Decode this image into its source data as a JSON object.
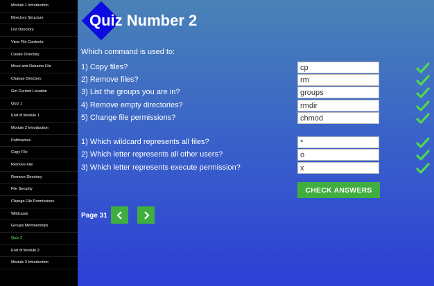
{
  "sidebar": {
    "items": [
      {
        "label": "Module 1 Introduction",
        "active": false
      },
      {
        "label": "Directory Structure",
        "active": false
      },
      {
        "label": "List Directory",
        "active": false
      },
      {
        "label": "View File Contents",
        "active": false
      },
      {
        "label": "Create Directory",
        "active": false
      },
      {
        "label": "Move and Rename File",
        "active": false
      },
      {
        "label": "Change Directory",
        "active": false
      },
      {
        "label": "Get Current Location",
        "active": false
      },
      {
        "label": "Quiz 1",
        "active": false
      },
      {
        "label": "End of Module 1",
        "active": false
      },
      {
        "label": "Module 2 Introduction",
        "active": false
      },
      {
        "label": "Pathnames",
        "active": false
      },
      {
        "label": "Copy File",
        "active": false
      },
      {
        "label": "Remove File",
        "active": false
      },
      {
        "label": "Remove Directory",
        "active": false
      },
      {
        "label": "File Security",
        "active": false
      },
      {
        "label": "Change File Permissions",
        "active": false
      },
      {
        "label": "Wildcards",
        "active": false
      },
      {
        "label": "Groups Memberships",
        "active": false
      },
      {
        "label": "Quiz 2",
        "active": true
      },
      {
        "label": "End of Module 2",
        "active": false
      },
      {
        "label": "Module 3 Introduction",
        "active": false
      }
    ]
  },
  "quiz": {
    "title": "Quiz Number 2",
    "intro": "Which command is used to:",
    "questions": [
      {
        "label": "1) Copy files?",
        "answer": "cp",
        "correct": true
      },
      {
        "label": "2) Remove files?",
        "answer": "rm",
        "correct": true
      },
      {
        "label": "3) List the groups you are in?",
        "answer": "groups",
        "correct": true
      },
      {
        "label": "4) Remove empty directories?",
        "answer": "rmdir",
        "correct": true
      },
      {
        "label": "5) Change file permissions?",
        "answer": "chmod",
        "correct": true
      },
      {
        "label": "1) Which wildcard represents all files?",
        "answer": "*",
        "correct": true
      },
      {
        "label": "2) Which letter represents all other users?",
        "answer": "o",
        "correct": true
      },
      {
        "label": "3) Which letter represents execute permission?",
        "answer": "x",
        "correct": true
      }
    ],
    "check_button_label": "CHECK ANSWERS",
    "page_label": "Page 31",
    "prev_icon": "chevron-left-icon",
    "next_icon": "chevron-right-icon"
  },
  "colors": {
    "accent_green": "#3fae3f",
    "check_green": "#4fd94f",
    "active_nav": "#4ff04f",
    "logo_blue": "#0c0ce0"
  }
}
